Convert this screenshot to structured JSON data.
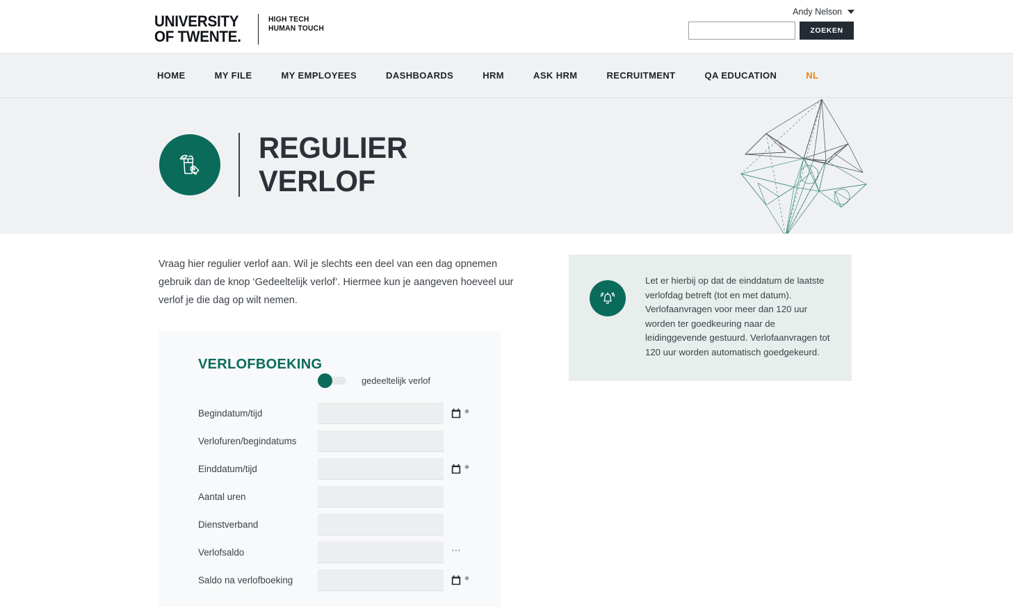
{
  "topbar": {
    "logo_main": "UNIVERSITY\nOF TWENTE.",
    "logo_tagline": "HIGH TECH\nHUMAN TOUCH",
    "user_name": "Andy Nelson",
    "search_value": "",
    "search_placeholder": "",
    "search_button": "ZOEKEN"
  },
  "nav": {
    "items": [
      {
        "label": "HOME",
        "active": false
      },
      {
        "label": "MY FILE",
        "active": false
      },
      {
        "label": "MY EMPLOYEES",
        "active": false
      },
      {
        "label": "DASHBOARDS",
        "active": false
      },
      {
        "label": "HRM",
        "active": false
      },
      {
        "label": "ASK HRM",
        "active": false
      },
      {
        "label": "RECRUITMENT",
        "active": false
      },
      {
        "label": "QA EDUCATION",
        "active": false
      }
    ],
    "language": "NL"
  },
  "hero": {
    "title": "REGULIER\nVERLOF",
    "icon": "cocktail-drink-tag-icon",
    "graphic": "wireframe-star-polyhedron"
  },
  "main": {
    "intro": "Vraag hier regulier verlof aan. Wil je slechts een deel van een dag opnemen gebruik dan de knop ‘Gedeeltelijk verlof’. Hiermee kun je aangeven hoeveel uur verlof je die dag op wilt nemen.",
    "notice": {
      "icon": "bell-icon",
      "text": "Let er hierbij op dat de einddatum de laatste verlofdag betreft (tot en met datum). Verlofaanvragen voor meer dan 120 uur worden ter goedkeuring naar de leidinggevende gestuurd. Verlofaanvragen tot 120 uur worden automatisch goedgekeurd."
    }
  },
  "form": {
    "title": "VERLOFBOEKING",
    "toggle": {
      "label": "gedeeltelijk verlof",
      "state": "off"
    },
    "fields": [
      {
        "label": "Begindatum/tijd",
        "value": "",
        "adorn": "calendar",
        "required": true
      },
      {
        "label": "Verlofuren/begindatums",
        "value": "",
        "adorn": "none",
        "required": false
      },
      {
        "label": "Einddatum/tijd",
        "value": "",
        "adorn": "calendar",
        "required": true
      },
      {
        "label": "Aantal uren",
        "value": "",
        "adorn": "none",
        "required": false
      },
      {
        "label": "Dienstverband",
        "value": "",
        "adorn": "none",
        "required": false
      },
      {
        "label": "Verlofsaldo",
        "value": "",
        "adorn": "ellipsis",
        "required": false
      },
      {
        "label": "Saldo na verlofboeking",
        "value": "",
        "adorn": "calendar",
        "required": true
      }
    ]
  },
  "colors": {
    "brand_green": "#0a6b5b",
    "accent_orange": "#e8870b",
    "dark": "#242b33",
    "band_gray": "#f0f1f3",
    "notice_bg": "#e8eeec",
    "panel_bg": "#f8f9fa",
    "input_bg": "#eceef0"
  }
}
